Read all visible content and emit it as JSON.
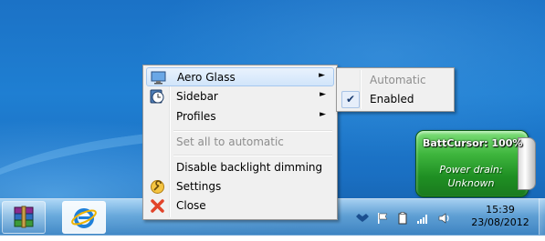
{
  "context_menu": {
    "items": [
      {
        "label": "Aero Glass",
        "arrow": "►"
      },
      {
        "label": "Sidebar",
        "arrow": "►"
      },
      {
        "label": "Profiles",
        "arrow": "►"
      },
      {
        "label": "Set all to automatic"
      },
      {
        "label": "Disable backlight dimming"
      },
      {
        "label": "Settings"
      },
      {
        "label": "Close"
      }
    ]
  },
  "submenu": {
    "items": [
      {
        "label": "Automatic",
        "disabled": true
      },
      {
        "label": "Enabled",
        "checked": true,
        "check_glyph": "✔"
      }
    ]
  },
  "gadget": {
    "title": "BattCursor: 100%",
    "drain_label": "Power drain:",
    "drain_value": "Unknown",
    "color": "#3fb63e"
  },
  "taskbar": {
    "pinned": [
      "winrar-icon",
      "internet-explorer-icon"
    ],
    "tray_icons": [
      "dropbox-icon",
      "action-center-flag-icon",
      "battery-icon",
      "network-signal-icon",
      "volume-icon"
    ],
    "time": "15:39",
    "date": "23/08/2012"
  },
  "colors": {
    "highlight": "#d1e5fa",
    "disabled_text": "#8d8d8d",
    "desktop": "#1f7fd2"
  }
}
